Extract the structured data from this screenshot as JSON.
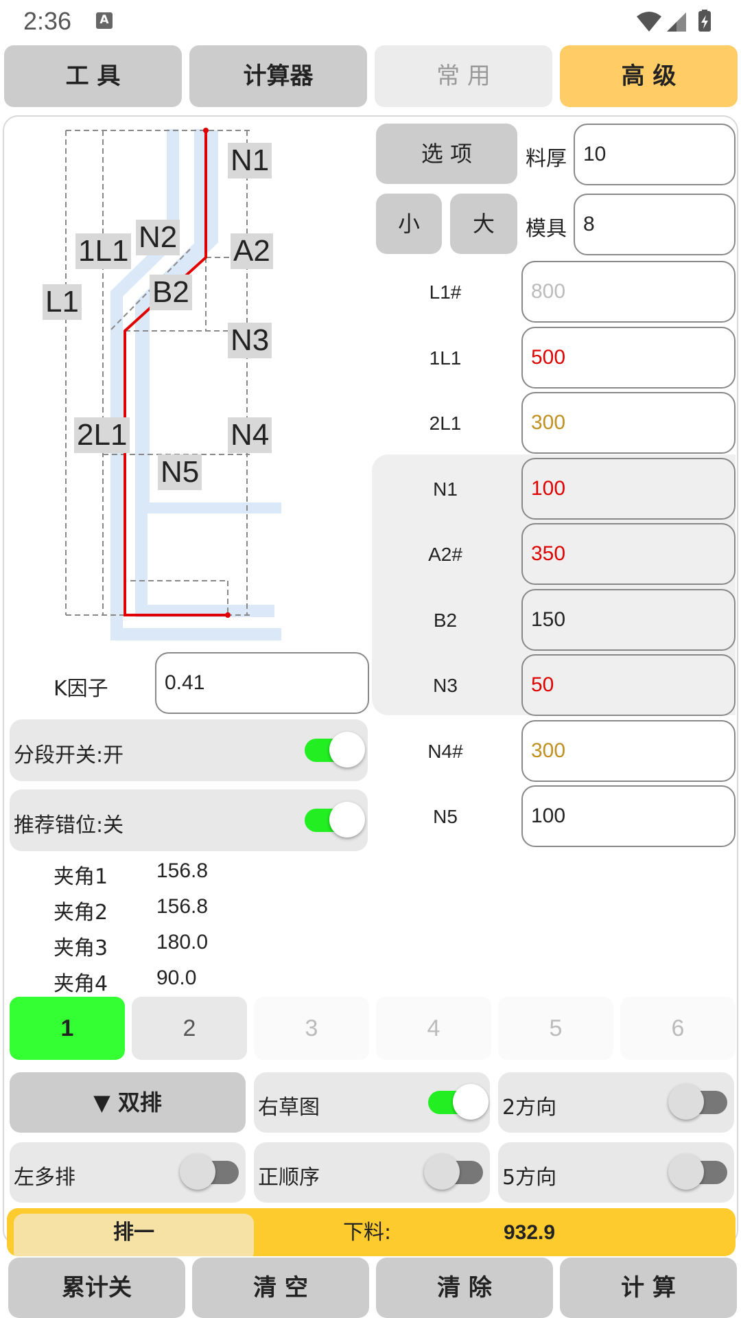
{
  "status": {
    "time": "2:36",
    "notif_letter": "A"
  },
  "tabs": [
    {
      "label": "工 具"
    },
    {
      "label": "计算器"
    },
    {
      "label": "常 用"
    },
    {
      "label": "高 级"
    }
  ],
  "diagram": {
    "labels": {
      "n1": "N1",
      "n2": "N2",
      "a2": "A2",
      "b2": "B2",
      "l1_1": "1L1",
      "l1": "L1",
      "n3": "N3",
      "l1_2": "2L1",
      "n4": "N4",
      "n5": "N5"
    },
    "colors": {
      "profile": "#dbe8f8",
      "path": "#e00000",
      "dims": "#888888"
    }
  },
  "options": {
    "options_btn": "选 项",
    "thickness_label": "料厚",
    "thickness_value": "10",
    "small_btn": "小",
    "large_btn": "大",
    "die_label": "模具",
    "die_value": "8"
  },
  "params": [
    {
      "label": "L1#",
      "value": "800",
      "color": "#bbbbbb"
    },
    {
      "label": "1L1",
      "value": "500",
      "color": "#dd0000"
    },
    {
      "label": "2L1",
      "value": "300",
      "color": "#c09020"
    },
    {
      "label": "N1",
      "value": "100",
      "color": "#dd0000"
    },
    {
      "label": "A2#",
      "value": "350",
      "color": "#dd0000"
    },
    {
      "label": "B2",
      "value": "150",
      "color": "#222222"
    },
    {
      "label": "N3",
      "value": "50",
      "color": "#dd0000"
    },
    {
      "label": "N4#",
      "value": "300",
      "color": "#c09020"
    },
    {
      "label": "N5",
      "value": "100",
      "color": "#222222"
    }
  ],
  "kfactor": {
    "label": "K因子",
    "value": "0.41"
  },
  "switches": {
    "segment": {
      "label": "分段开关:开",
      "on": true
    },
    "offset": {
      "label": "推荐错位:关",
      "on": true
    }
  },
  "angles": [
    {
      "label": "夹角1",
      "value": "156.8"
    },
    {
      "label": "夹角2",
      "value": "156.8"
    },
    {
      "label": "夹角3",
      "value": "180.0"
    },
    {
      "label": "夹角4",
      "value": "90.0"
    }
  ],
  "num_tabs": [
    "1",
    "2",
    "3",
    "4",
    "5",
    "6"
  ],
  "controls": {
    "double_row": "▼  双排",
    "right_sketch": {
      "label": "右草图",
      "on": true
    },
    "dir2": {
      "label": "2方向",
      "on": false
    },
    "left_multi": {
      "label": "左多排",
      "on": false
    },
    "positive_order": {
      "label": "正顺序",
      "on": false
    },
    "dir5": {
      "label": "5方向",
      "on": false
    }
  },
  "result": {
    "tab": "排一",
    "label": "下料:",
    "value": "932.9"
  },
  "bottom": [
    "累计关",
    "清 空",
    "清 除",
    "计 算"
  ]
}
